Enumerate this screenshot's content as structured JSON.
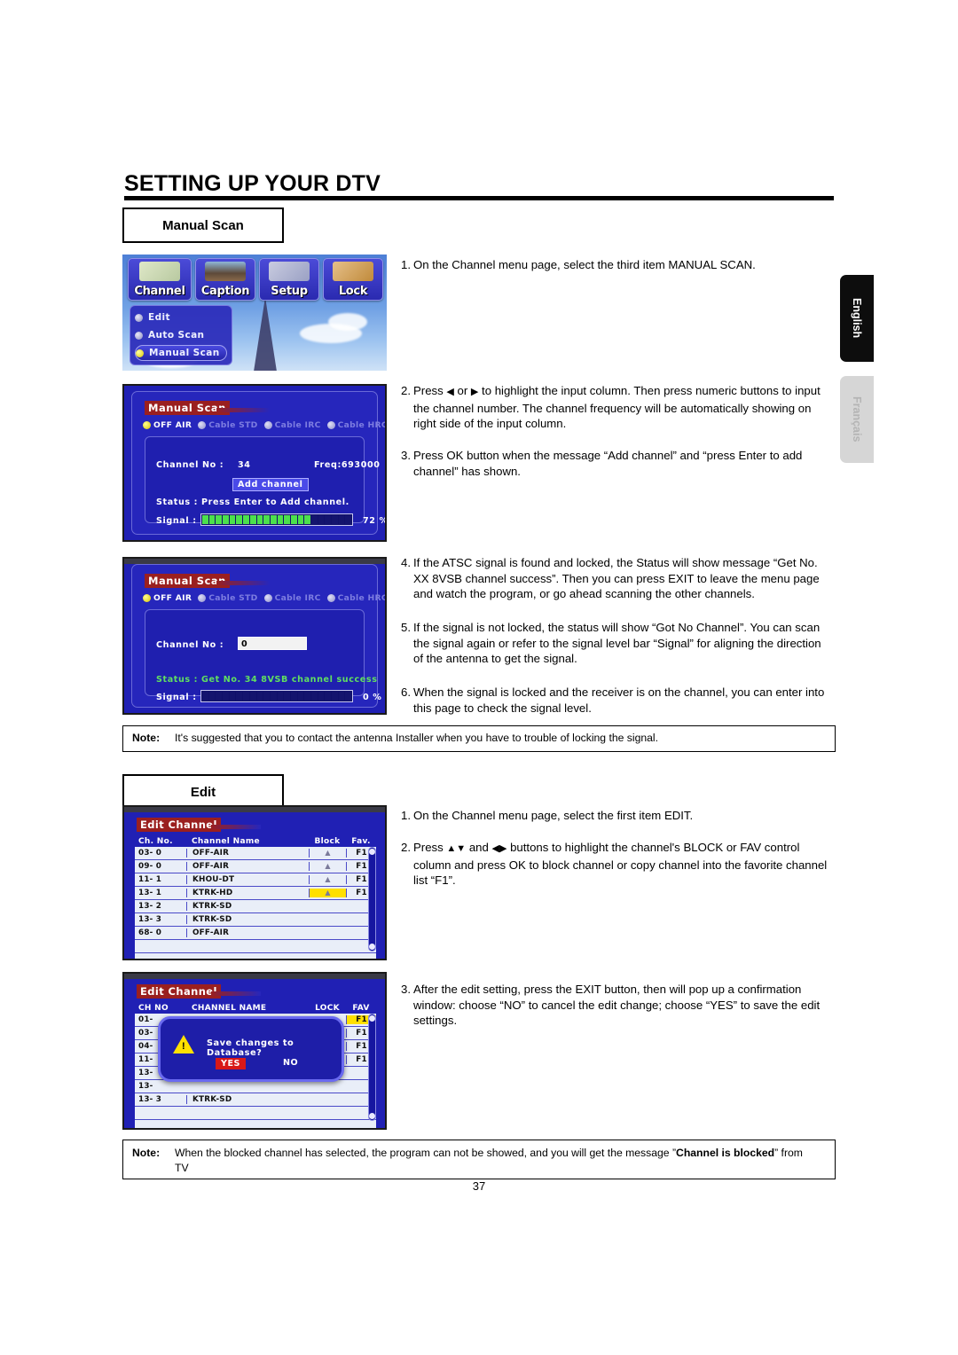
{
  "document": {
    "title": "SETTING UP YOUR DTV",
    "page_number": "37"
  },
  "side_tabs": [
    {
      "label": "English",
      "active": true
    },
    {
      "label": "Français",
      "active": false
    }
  ],
  "sections": [
    {
      "heading": "Manual Scan",
      "steps": [
        {
          "num": "1.",
          "text": "On the Channel menu page, select the third item MANUAL SCAN."
        },
        {
          "num": "2.",
          "text_pre": "Press ",
          "arrow_left": "◀",
          "text_mid": " or ",
          "arrow_right": "▶",
          "text_post": " to highlight the input column. Then press numeric buttons to input the channel number. The channel frequency will be automatically showing on right side of the input column."
        },
        {
          "num": "3.",
          "text": "Press OK button when the message “Add channel” and “press Enter to add channel” has shown."
        },
        {
          "num": "4.",
          "text": "If the ATSC signal is found and locked, the Status will show message “Get No. XX 8VSB channel success”. Then you can press EXIT to leave the menu page and watch the program, or go ahead scanning the other channels."
        },
        {
          "num": "5.",
          "text": "If the signal is not locked, the status will show “Got No Channel”. You can scan the signal again or refer to the signal level bar “Signal” for aligning the direction of the antenna to get the signal."
        },
        {
          "num": "6.",
          "text": "When the signal is locked and the receiver is on the channel, you can enter into this page to check the signal level."
        }
      ],
      "note": {
        "label": "Note:",
        "text": "It's suggested that you to contact the antenna Installer when you have to trouble of locking the signal."
      }
    },
    {
      "heading": "Edit",
      "steps": [
        {
          "num": "1.",
          "text": "On the Channel menu page, select the first item EDIT."
        },
        {
          "num": "2.",
          "text_pre": "Press ",
          "arrow_up": "▲",
          "arrow_down": "▼",
          "text_mid": " and ",
          "arrow_left": "◀",
          "arrow_right": "▶",
          "text_post": " buttons to highlight the channel's BLOCK or FAV control column and press OK to block channel or copy channel into the favorite channel list “F1”."
        },
        {
          "num": "3.",
          "text": "After the edit setting, press the EXIT button, then will pop up a confirmation window: choose “NO” to cancel the edit change; choose “YES” to save the edit settings."
        }
      ],
      "note": {
        "label": "Note:",
        "text_pre": "When the blocked channel has selected, the program can not be showed, and you will get the message ”",
        "bold": "Channel is blocked",
        "text_post": "” from TV"
      }
    }
  ],
  "screenshots": {
    "channel_menu": {
      "tabs": [
        {
          "label": "Channel",
          "icon": "remote-control-icon",
          "active": true
        },
        {
          "label": "Caption",
          "icon": "picture-icon",
          "active": false
        },
        {
          "label": "Setup",
          "icon": "tools-icon",
          "active": false
        },
        {
          "label": "Lock",
          "icon": "padlock-icon",
          "active": false
        }
      ],
      "items": [
        {
          "label": "Edit",
          "selected": false
        },
        {
          "label": "Auto  Scan",
          "selected": false
        },
        {
          "label": "Manual  Scan",
          "selected": true
        }
      ]
    },
    "manual_scan_1": {
      "title": "Manual Scan",
      "sources": [
        {
          "label": "OFF AIR",
          "selected": true
        },
        {
          "label": "Cable STD",
          "selected": false
        },
        {
          "label": "Cable IRC",
          "selected": false
        },
        {
          "label": "Cable HRC",
          "selected": false
        }
      ],
      "channel_label": "Channel No :",
      "channel_value": "34",
      "freq": "Freq:693000",
      "add_button": "Add channel",
      "status": "Status : Press Enter to Add channel.",
      "signal_label": "Signal :",
      "signal_percent": "72 %",
      "signal_value": 72
    },
    "manual_scan_2": {
      "title": "Manual Scan",
      "sources": [
        {
          "label": "OFF AIR",
          "selected": true
        },
        {
          "label": "Cable STD",
          "selected": false
        },
        {
          "label": "Cable IRC",
          "selected": false
        },
        {
          "label": "Cable HRC",
          "selected": false
        }
      ],
      "channel_label": "Channel No :",
      "channel_value": "0",
      "status": "Status : Get No. 34   8VSB channel success",
      "signal_label": "Signal :",
      "signal_percent": "0  %",
      "signal_value": 0
    },
    "edit_channel": {
      "title": "Edit Channel",
      "columns": [
        "Ch. No.",
        "Channel Name",
        "Block",
        "Fav."
      ],
      "rows": [
        {
          "no": "03- 0",
          "name": "OFF-AIR",
          "block": "▲",
          "fav": "F1",
          "block_hl": false
        },
        {
          "no": "09- 0",
          "name": "OFF-AIR",
          "block": "▲",
          "fav": "F1",
          "block_hl": false
        },
        {
          "no": "11- 1",
          "name": "KHOU-DT",
          "block": "▲",
          "fav": "F1",
          "block_hl": false
        },
        {
          "no": "13- 1",
          "name": "KTRK-HD",
          "block": "▲",
          "fav": "F1",
          "block_hl": true
        },
        {
          "no": "13- 2",
          "name": "KTRK-SD",
          "block": "",
          "fav": "",
          "block_hl": false
        },
        {
          "no": "13- 3",
          "name": "KTRK-SD",
          "block": "",
          "fav": "",
          "block_hl": false
        },
        {
          "no": "68- 0",
          "name": "OFF-AIR",
          "block": "",
          "fav": "",
          "block_hl": false
        },
        {
          "no": "",
          "name": "",
          "block": "",
          "fav": "",
          "block_hl": false
        },
        {
          "no": "",
          "name": "",
          "block": "",
          "fav": "",
          "block_hl": false
        }
      ]
    },
    "edit_channel_confirm": {
      "title": "Edit Channel",
      "columns": [
        "CH NO",
        "CHANNEL NAME",
        "LOCK",
        "FAV"
      ],
      "rows": [
        {
          "no": "01-",
          "name": "",
          "lock": "",
          "fav": "F1",
          "fav_hl": true
        },
        {
          "no": "03-",
          "name": "",
          "lock": "",
          "fav": "F1",
          "fav_hl": false
        },
        {
          "no": "04-",
          "name": "",
          "lock": "",
          "fav": "F1",
          "fav_hl": false
        },
        {
          "no": "11-",
          "name": "",
          "lock": "",
          "fav": "F1",
          "fav_hl": false
        },
        {
          "no": "13-",
          "name": "",
          "lock": "",
          "fav": "",
          "fav_hl": false
        },
        {
          "no": "13-",
          "name": "",
          "lock": "",
          "fav": "",
          "fav_hl": false
        },
        {
          "no": "13- 3",
          "name": "KTRK-SD",
          "lock": "",
          "fav": "",
          "fav_hl": false
        },
        {
          "no": "",
          "name": "",
          "lock": "",
          "fav": "",
          "fav_hl": false
        },
        {
          "no": "",
          "name": "",
          "lock": "",
          "fav": "",
          "fav_hl": false
        }
      ],
      "dialog": {
        "message": "Save changes to Database?",
        "yes": "YES",
        "no": "NO",
        "icon": "warning-icon"
      }
    }
  }
}
